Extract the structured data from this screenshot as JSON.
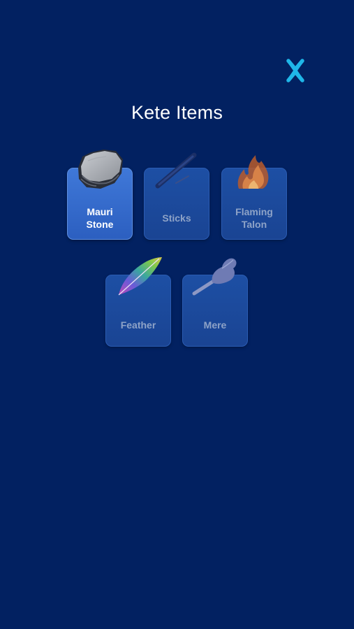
{
  "screen": {
    "title": "Kete Items",
    "close_label": "X"
  },
  "items": [
    {
      "label_line1": "Mauri",
      "label_line2": "Stone",
      "state": "selected",
      "icon": "mauri-stone-icon"
    },
    {
      "label_line1": "Sticks",
      "label_line2": "",
      "state": "locked",
      "icon": "sticks-icon"
    },
    {
      "label_line1": "Flaming",
      "label_line2": "Talon",
      "state": "locked",
      "icon": "flame-icon"
    },
    {
      "label_line1": "Feather",
      "label_line2": "",
      "state": "locked",
      "icon": "feather-icon"
    },
    {
      "label_line1": "Mere",
      "label_line2": "",
      "state": "locked",
      "icon": "mere-icon"
    }
  ],
  "colors": {
    "background": "#022161",
    "accent": "#1fb6e8",
    "tile_active": "#3a70d2",
    "tile_locked": "#1c4a9c"
  }
}
